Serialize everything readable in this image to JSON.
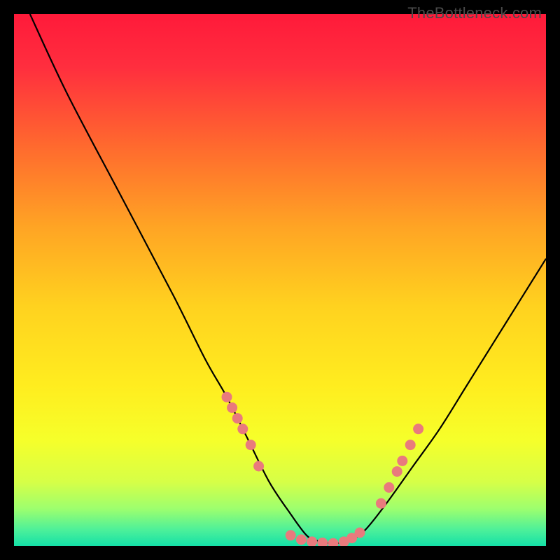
{
  "watermark": {
    "text": "TheBottleneck.com"
  },
  "chart_data": {
    "type": "line",
    "title": "",
    "xlabel": "",
    "ylabel": "",
    "xlim": [
      0,
      100
    ],
    "ylim": [
      0,
      100
    ],
    "gradient_stops": [
      {
        "offset": 0,
        "color": "#ff1a3a"
      },
      {
        "offset": 0.1,
        "color": "#ff2e3e"
      },
      {
        "offset": 0.25,
        "color": "#ff6a2e"
      },
      {
        "offset": 0.4,
        "color": "#ffa424"
      },
      {
        "offset": 0.55,
        "color": "#ffd21f"
      },
      {
        "offset": 0.7,
        "color": "#ffed1f"
      },
      {
        "offset": 0.8,
        "color": "#f6ff2a"
      },
      {
        "offset": 0.88,
        "color": "#d6ff47"
      },
      {
        "offset": 0.93,
        "color": "#9dff6e"
      },
      {
        "offset": 0.97,
        "color": "#4cf09a"
      },
      {
        "offset": 1.0,
        "color": "#14e0a7"
      }
    ],
    "series": [
      {
        "name": "bottleneck-curve",
        "x": [
          3,
          10,
          20,
          30,
          36,
          40,
          44,
          48,
          52,
          55,
          57,
          60,
          63,
          66,
          70,
          75,
          80,
          85,
          90,
          95,
          100
        ],
        "y": [
          100,
          85,
          66,
          47,
          35,
          28,
          20,
          12,
          6,
          2,
          1,
          0.5,
          1,
          3,
          8,
          15,
          22,
          30,
          38,
          46,
          54
        ]
      }
    ],
    "markers": {
      "name": "highlight-dots",
      "color": "#e97a7d",
      "points": [
        {
          "x": 40,
          "y": 28
        },
        {
          "x": 41,
          "y": 26
        },
        {
          "x": 42,
          "y": 24
        },
        {
          "x": 43,
          "y": 22
        },
        {
          "x": 44.5,
          "y": 19
        },
        {
          "x": 46,
          "y": 15
        },
        {
          "x": 52,
          "y": 2
        },
        {
          "x": 54,
          "y": 1.2
        },
        {
          "x": 56,
          "y": 0.8
        },
        {
          "x": 58,
          "y": 0.6
        },
        {
          "x": 60,
          "y": 0.5
        },
        {
          "x": 62,
          "y": 0.8
        },
        {
          "x": 63.5,
          "y": 1.5
        },
        {
          "x": 65,
          "y": 2.5
        },
        {
          "x": 69,
          "y": 8
        },
        {
          "x": 70.5,
          "y": 11
        },
        {
          "x": 72,
          "y": 14
        },
        {
          "x": 73,
          "y": 16
        },
        {
          "x": 74.5,
          "y": 19
        },
        {
          "x": 76,
          "y": 22
        }
      ]
    }
  }
}
